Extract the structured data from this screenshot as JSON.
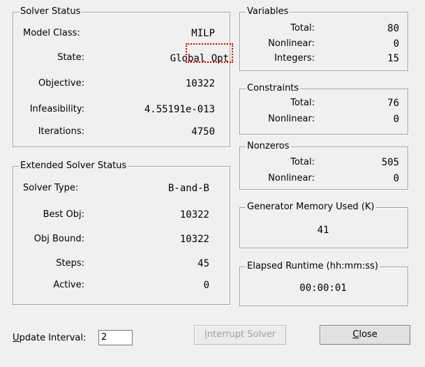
{
  "solver_status": {
    "title": "Solver Status",
    "model_class_label": "Model Class:",
    "model_class_value": "MILP",
    "state_label": "State:",
    "state_value": "Global Opt",
    "objective_label": "Objective:",
    "objective_value": "10322",
    "infeasibility_label": "Infeasibility:",
    "infeasibility_value": "4.55191e-013",
    "iterations_label": "Iterations:",
    "iterations_value": "4750"
  },
  "extended_status": {
    "title": "Extended Solver Status",
    "solver_type_label": "Solver Type:",
    "solver_type_value": "B-and-B",
    "best_obj_label": "Best Obj:",
    "best_obj_value": "10322",
    "obj_bound_label": "Obj Bound:",
    "obj_bound_value": "10322",
    "steps_label": "Steps:",
    "steps_value": "45",
    "active_label": "Active:",
    "active_value": "0"
  },
  "variables": {
    "title": "Variables",
    "total_label": "Total:",
    "total_value": "80",
    "nonlinear_label": "Nonlinear:",
    "nonlinear_value": "0",
    "integers_label": "Integers:",
    "integers_value": "15"
  },
  "constraints": {
    "title": "Constraints",
    "total_label": "Total:",
    "total_value": "76",
    "nonlinear_label": "Nonlinear:",
    "nonlinear_value": "0"
  },
  "nonzeros": {
    "title": "Nonzeros",
    "total_label": "Total:",
    "total_value": "505",
    "nonlinear_label": "Nonlinear:",
    "nonlinear_value": "0"
  },
  "memory": {
    "title": "Generator Memory Used (K)",
    "value": "41"
  },
  "runtime": {
    "title": "Elapsed Runtime (hh:mm:ss)",
    "value": "00:00:01"
  },
  "footer": {
    "update_interval_label_underlined": "U",
    "update_interval_label_rest": "pdate Interval:",
    "update_interval_value": "2",
    "interrupt_button_underlined": "I",
    "interrupt_button_rest": "nterrupt Solver",
    "close_button_underlined": "C",
    "close_button_rest": "lose"
  },
  "colors": {
    "highlight_box": "#e00000",
    "background": "#f0f0f0"
  }
}
